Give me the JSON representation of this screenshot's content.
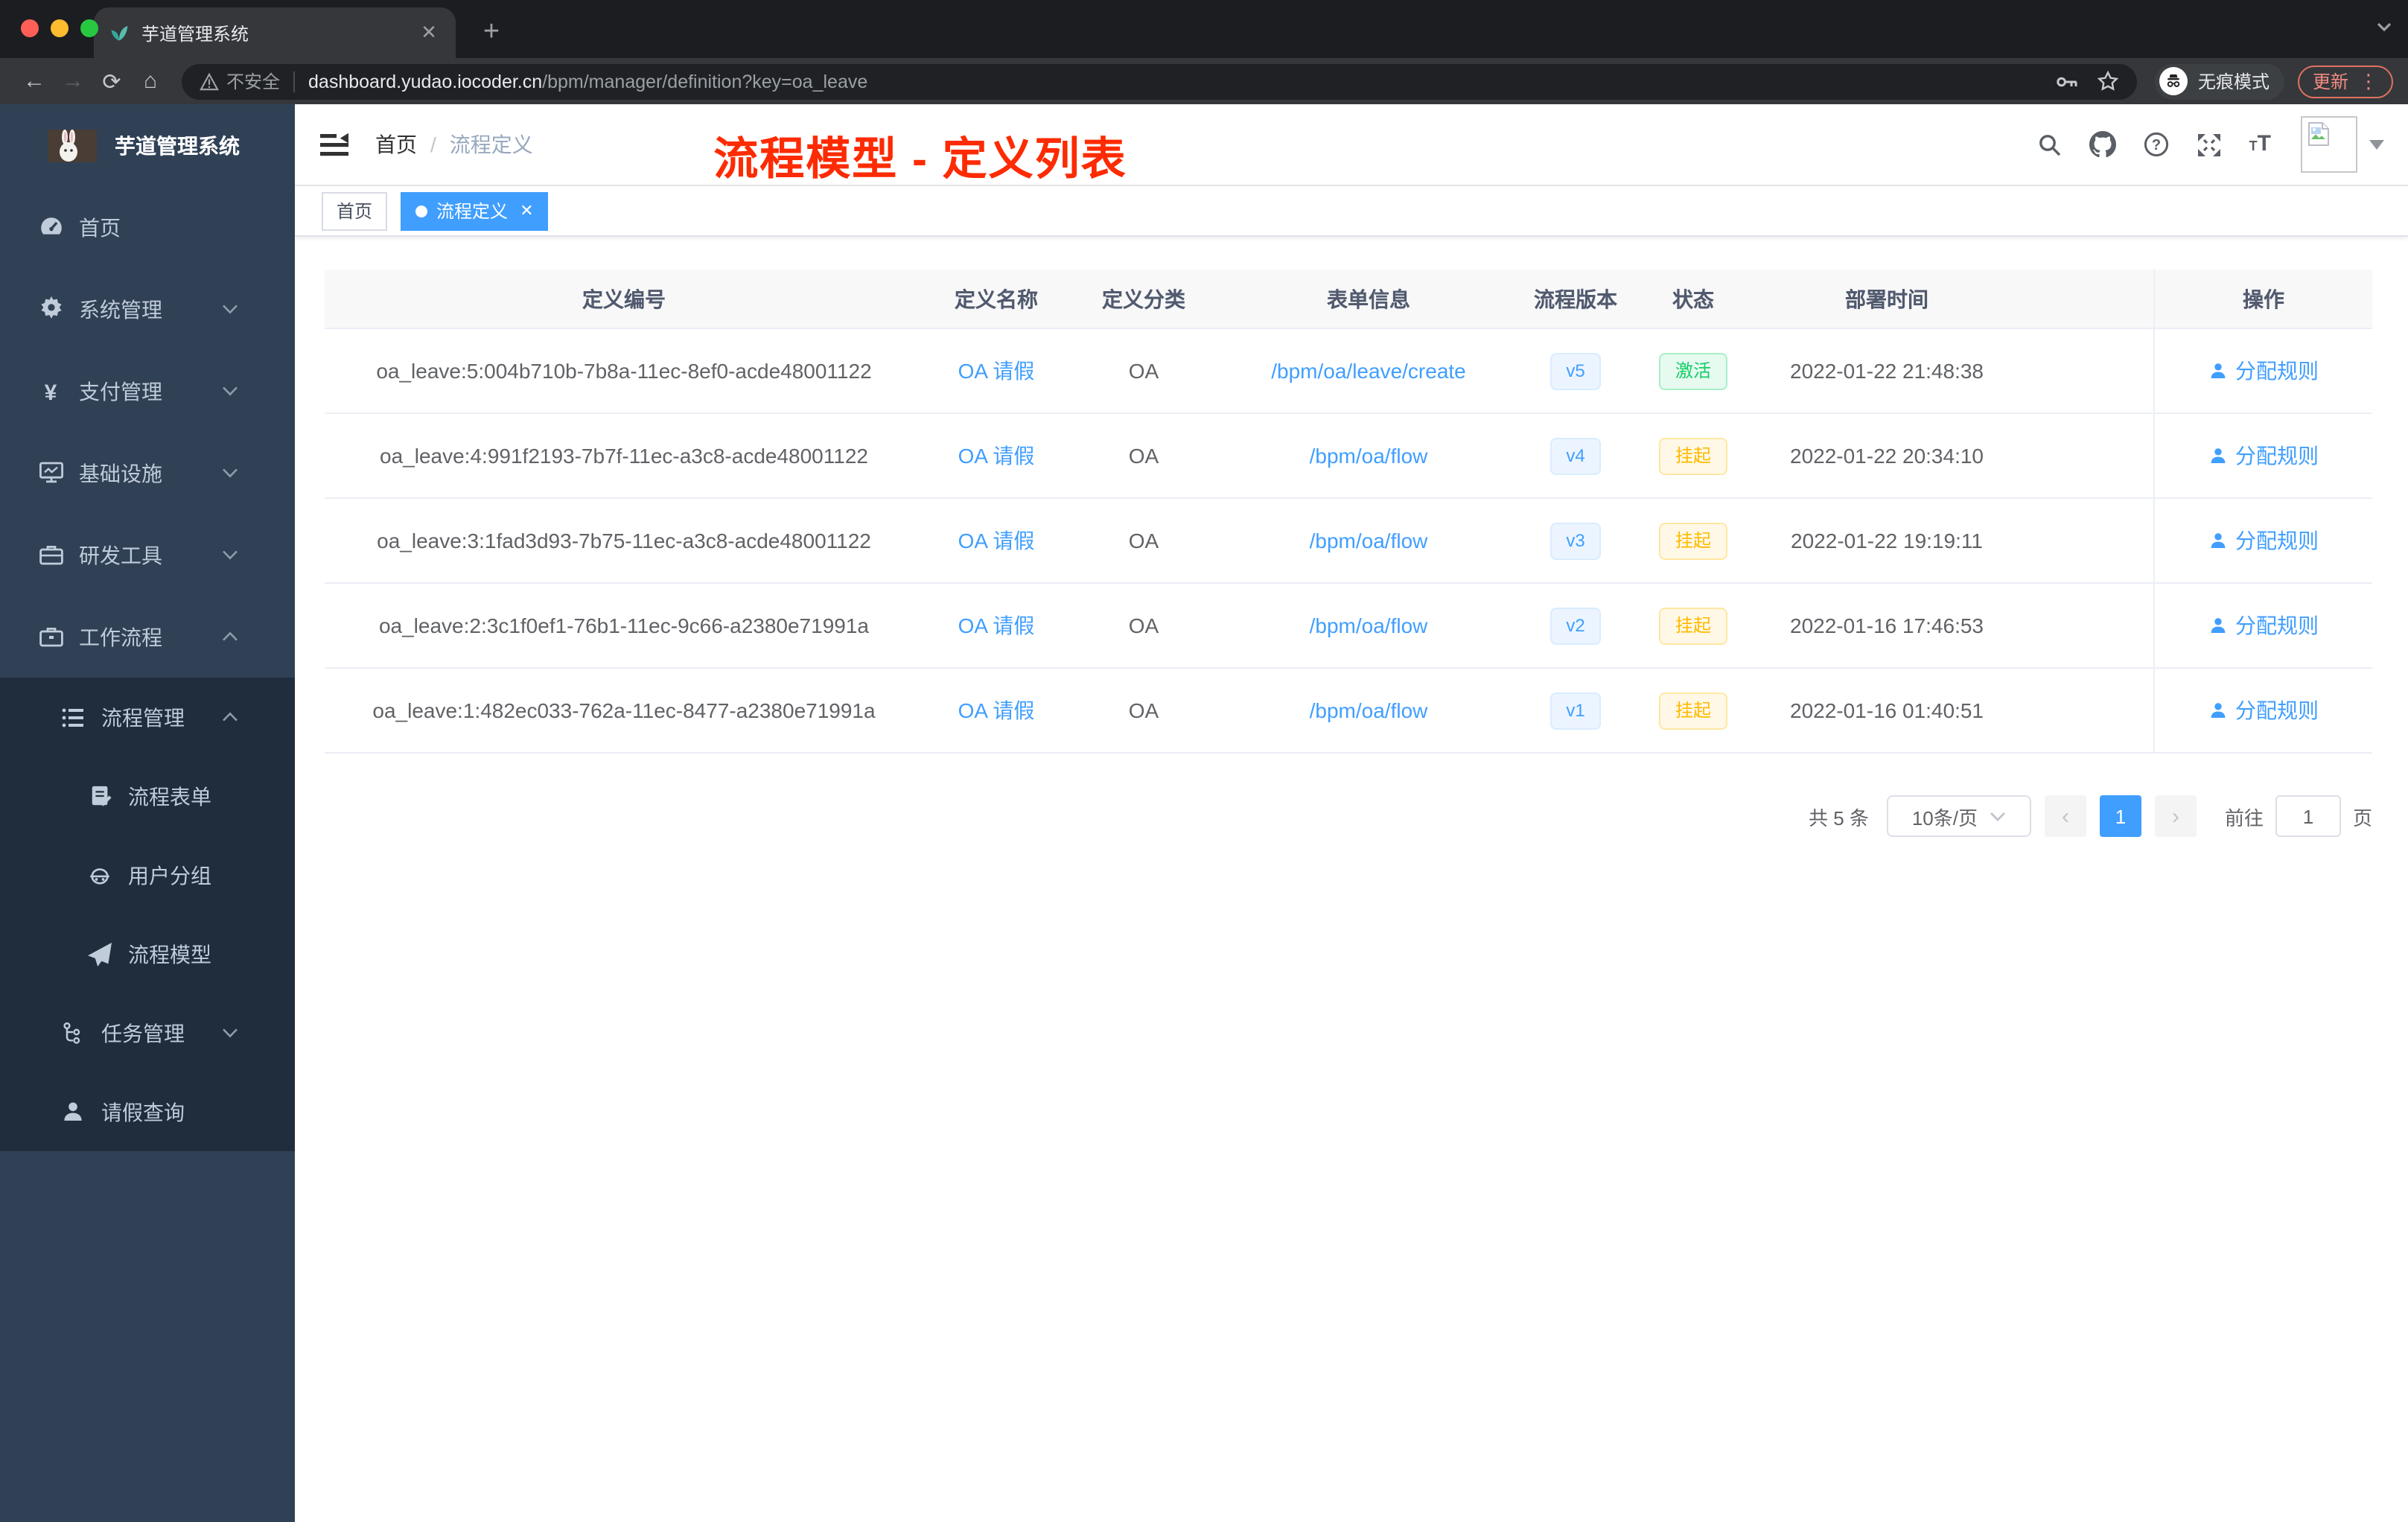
{
  "browser": {
    "tab_title": "芋道管理系统",
    "tab_close": "✕",
    "new_tab_label": "+",
    "security_label": "不安全",
    "url_domain": "dashboard.yudao.iocoder.cn",
    "url_path": "/bpm/manager/definition?key=oa_leave",
    "incognito_label": "无痕模式",
    "update_label": "更新",
    "kebab": "⋮",
    "traffic_colors": {
      "close": "#ff5f57",
      "minimize": "#febc2e",
      "zoom": "#28c840"
    }
  },
  "sidebar": {
    "app_title": "芋道管理系统",
    "menu": [
      {
        "label": "首页",
        "icon": "dashboard-icon",
        "level": 1,
        "arrow": "",
        "dark": false
      },
      {
        "label": "系统管理",
        "icon": "gear-icon",
        "level": 1,
        "arrow": "down",
        "dark": false
      },
      {
        "label": "支付管理",
        "icon": "yen-icon",
        "level": 1,
        "arrow": "down",
        "dark": false
      },
      {
        "label": "基础设施",
        "icon": "monitor-icon",
        "level": 1,
        "arrow": "down",
        "dark": false
      },
      {
        "label": "研发工具",
        "icon": "toolbox-icon",
        "level": 1,
        "arrow": "down",
        "dark": false
      },
      {
        "label": "工作流程",
        "icon": "briefcase-icon",
        "level": 1,
        "arrow": "up",
        "dark": false
      },
      {
        "label": "流程管理",
        "icon": "list-icon",
        "level": 2,
        "arrow": "up",
        "dark": true
      },
      {
        "label": "流程表单",
        "icon": "form-icon",
        "level": 3,
        "arrow": "",
        "dark": true
      },
      {
        "label": "用户分组",
        "icon": "robot-icon",
        "level": 3,
        "arrow": "",
        "dark": true
      },
      {
        "label": "流程模型",
        "icon": "send-icon",
        "level": 3,
        "arrow": "",
        "dark": true
      },
      {
        "label": "任务管理",
        "icon": "tree-icon",
        "level": 2,
        "arrow": "down",
        "dark": true
      },
      {
        "label": "请假查询",
        "icon": "user-icon",
        "level": 2,
        "arrow": "",
        "dark": true
      }
    ]
  },
  "header": {
    "breadcrumb_home": "首页",
    "breadcrumb_sep": "/",
    "breadcrumb_current": "流程定义",
    "annotation": "流程模型 - 定义列表",
    "annotation_color": "#fd2b02"
  },
  "tags": [
    {
      "label": "首页",
      "active": false
    },
    {
      "label": "流程定义",
      "active": true,
      "close": "✕"
    }
  ],
  "table": {
    "columns": [
      "定义编号",
      "定义名称",
      "定义分类",
      "表单信息",
      "流程版本",
      "状态",
      "部署时间",
      "",
      "操作"
    ],
    "action_label": "分配规则",
    "rows": [
      {
        "id": "oa_leave:5:004b710b-7b8a-11ec-8ef0-acde48001122",
        "name": "OA 请假",
        "category": "OA",
        "form": "/bpm/oa/leave/create",
        "version": "v5",
        "status": "激活",
        "status_type": "success",
        "time": "2022-01-22 21:48:38"
      },
      {
        "id": "oa_leave:4:991f2193-7b7f-11ec-a3c8-acde48001122",
        "name": "OA 请假",
        "category": "OA",
        "form": "/bpm/oa/flow",
        "version": "v4",
        "status": "挂起",
        "status_type": "warning",
        "time": "2022-01-22 20:34:10"
      },
      {
        "id": "oa_leave:3:1fad3d93-7b75-11ec-a3c8-acde48001122",
        "name": "OA 请假",
        "category": "OA",
        "form": "/bpm/oa/flow",
        "version": "v3",
        "status": "挂起",
        "status_type": "warning",
        "time": "2022-01-22 19:19:11"
      },
      {
        "id": "oa_leave:2:3c1f0ef1-76b1-11ec-9c66-a2380e71991a",
        "name": "OA 请假",
        "category": "OA",
        "form": "/bpm/oa/flow",
        "version": "v2",
        "status": "挂起",
        "status_type": "warning",
        "time": "2022-01-16 17:46:53"
      },
      {
        "id": "oa_leave:1:482ec033-762a-11ec-8477-a2380e71991a",
        "name": "OA 请假",
        "category": "OA",
        "form": "/bpm/oa/flow",
        "version": "v1",
        "status": "挂起",
        "status_type": "warning",
        "time": "2022-01-16 01:40:51"
      }
    ]
  },
  "pagination": {
    "total_label": "共 5 条",
    "page_size_label": "10条/页",
    "prev": "‹",
    "current_page": "1",
    "next": "›",
    "goto_label": "前往",
    "goto_value": "1",
    "page_unit": "页"
  },
  "colors": {
    "primary": "#409eff",
    "success": "#13ce66",
    "warning": "#ffba00",
    "sidebar": "#304156",
    "submenu": "#1f2d3d"
  }
}
